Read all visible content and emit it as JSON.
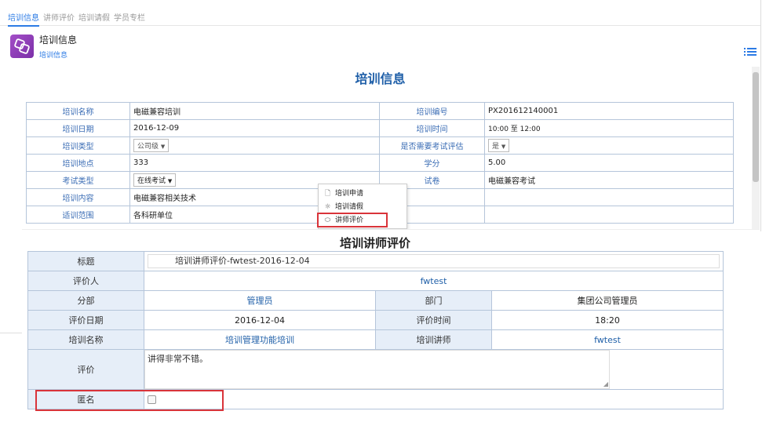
{
  "tabs": [
    "培训信息",
    "讲师评价",
    "培训请假",
    "学员专栏"
  ],
  "header": {
    "title": "培训信息",
    "subtitle": "培训信息"
  },
  "training_form": {
    "title": "培训信息",
    "rows": [
      {
        "l1": "培训名称",
        "v1": "电磁兼容培训",
        "l2": "培训编号",
        "v2": "PX201612140001"
      },
      {
        "l1": "培训日期",
        "v1": "2016-12-09",
        "l2": "培训时间",
        "v2": "10:00 至 12:00"
      },
      {
        "l1": "培训类型",
        "v1": "公司级",
        "l2": "是否需要考试评估",
        "v2": "是"
      },
      {
        "l1": "培训地点",
        "v1": "333",
        "l2": "学分",
        "v2": "5.00"
      },
      {
        "l1": "考试类型",
        "v1": "在线考试",
        "l2": "试卷",
        "v2": "电磁兼容考试"
      },
      {
        "l1": "培训内容",
        "v1": "电磁兼容相关技术",
        "l2": "",
        "v2": ""
      },
      {
        "l1": "适训范围",
        "v1": "各科研单位",
        "l2": "",
        "v2": ""
      }
    ],
    "dropdown_arrow": "▼"
  },
  "context_menu": {
    "items": [
      {
        "label": "培训申请",
        "icon": "document-icon"
      },
      {
        "label": "培训请假",
        "icon": "sun-icon"
      },
      {
        "label": "讲师评价",
        "icon": "tag-icon"
      }
    ]
  },
  "evaluation": {
    "title": "培训讲师评价",
    "subject_label": "标题",
    "subject_value": "培训讲师评价-fwtest-2016-12-04",
    "evaluator_label": "评价人",
    "evaluator_value": "fwtest",
    "branch_label": "分部",
    "branch_value": "管理员",
    "dept_label": "部门",
    "dept_value": "集团公司管理员",
    "date_label": "评价日期",
    "date_value": "2016-12-04",
    "time_label": "评价时间",
    "time_value": "18:20",
    "course_label": "培训名称",
    "course_value": "培训管理功能培训",
    "lecturer_label": "培训讲师",
    "lecturer_value": "fwtest",
    "comment_label": "评价",
    "comment_value": "讲得非常不错。",
    "anonymous_label": "匿名",
    "anonymous_checked": false
  },
  "colors": {
    "accent": "#2c7be5",
    "highlight": "#d9343a",
    "label_bg": "#e6eef8"
  }
}
